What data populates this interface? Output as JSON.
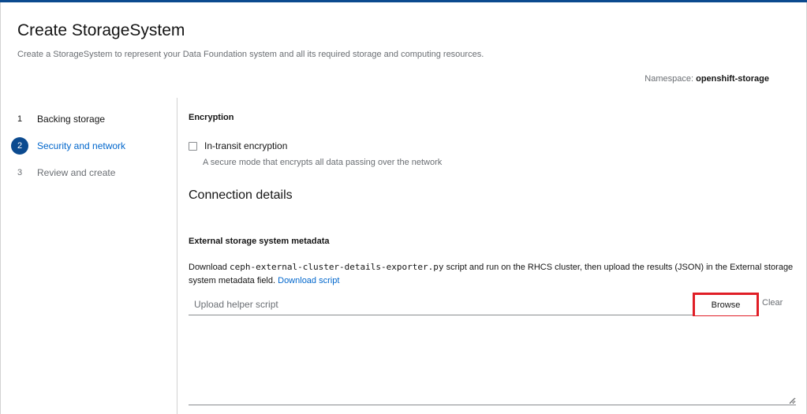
{
  "header": {
    "title": "Create StorageSystem",
    "description": "Create a StorageSystem to represent your Data Foundation system and all its required storage and computing resources.",
    "namespace_label": "Namespace:",
    "namespace_value": "openshift-storage"
  },
  "wizard": {
    "steps": [
      {
        "number": "1",
        "label": "Backing storage",
        "state": "done"
      },
      {
        "number": "2",
        "label": "Security and network",
        "state": "current"
      },
      {
        "number": "3",
        "label": "Review and create",
        "state": "disabled"
      }
    ]
  },
  "encryption": {
    "heading": "Encryption",
    "checkbox_label": "In-transit encryption",
    "checkbox_checked": false,
    "checkbox_description": "A secure mode that encrypts all data passing over the network"
  },
  "connection": {
    "heading": "Connection details",
    "metadata_label": "External storage system metadata",
    "help_prefix": "Download ",
    "help_script": "ceph-external-cluster-details-exporter.py",
    "help_suffix": " script and run on the RHCS cluster, then upload the results (JSON) in the External storage system metadata field.",
    "download_link": "Download script",
    "upload_placeholder": "Upload helper script",
    "browse_label": "Browse",
    "clear_label": "Clear",
    "metadata_value": ""
  },
  "colors": {
    "accent": "#0b4a8f",
    "link": "#0066cc",
    "highlight_box": "#e01e26"
  }
}
